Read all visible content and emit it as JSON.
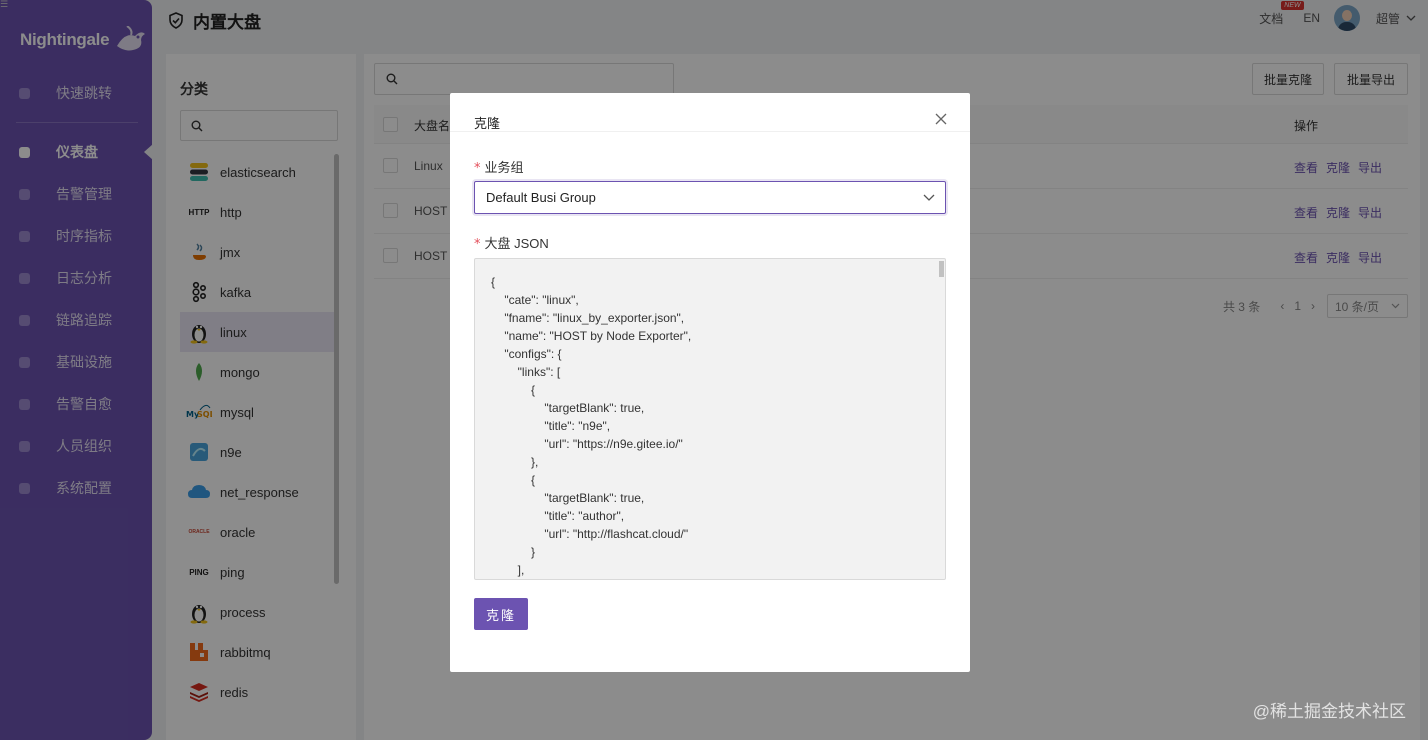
{
  "app": {
    "logo_text": "Nightingale",
    "page_title": "内置大盘"
  },
  "header": {
    "docs": "文档",
    "docs_badge": "NEW",
    "lang": "EN",
    "user": "超管"
  },
  "sidebar": {
    "items": [
      {
        "label": "快速跳转",
        "icon": "search-icon"
      },
      {
        "label": "仪表盘",
        "icon": "dashboard-icon",
        "active": true
      },
      {
        "label": "告警管理",
        "icon": "alarm-icon"
      },
      {
        "label": "时序指标",
        "icon": "line-chart-icon"
      },
      {
        "label": "日志分析",
        "icon": "log-icon"
      },
      {
        "label": "链路追踪",
        "icon": "trace-icon"
      },
      {
        "label": "基础设施",
        "icon": "infra-icon"
      },
      {
        "label": "告警自愈",
        "icon": "terminal-icon"
      },
      {
        "label": "人员组织",
        "icon": "user-icon"
      },
      {
        "label": "系统配置",
        "icon": "settings-icon"
      }
    ]
  },
  "categories": {
    "title": "分类",
    "items": [
      {
        "label": "elasticsearch",
        "icon": "elasticsearch-icon"
      },
      {
        "label": "http",
        "icon": "http-icon",
        "icon_text": "HTTP"
      },
      {
        "label": "jmx",
        "icon": "java-icon"
      },
      {
        "label": "kafka",
        "icon": "kafka-icon"
      },
      {
        "label": "linux",
        "icon": "linux-icon",
        "active": true
      },
      {
        "label": "mongo",
        "icon": "mongo-icon"
      },
      {
        "label": "mysql",
        "icon": "mysql-icon"
      },
      {
        "label": "n9e",
        "icon": "n9e-icon"
      },
      {
        "label": "net_response",
        "icon": "cloud-icon"
      },
      {
        "label": "oracle",
        "icon": "oracle-icon",
        "icon_text": "ORACLE"
      },
      {
        "label": "ping",
        "icon": "ping-icon",
        "icon_text": "PING"
      },
      {
        "label": "process",
        "icon": "linux-icon"
      },
      {
        "label": "rabbitmq",
        "icon": "rabbitmq-icon"
      },
      {
        "label": "redis",
        "icon": "redis-icon"
      }
    ]
  },
  "toolbar": {
    "batch_clone": "批量克隆",
    "batch_export": "批量导出"
  },
  "table": {
    "headers": {
      "name": "大盘名",
      "ops": "操作"
    },
    "rows": [
      {
        "name": "Linux"
      },
      {
        "name": "HOST"
      },
      {
        "name": "HOST"
      }
    ],
    "actions": {
      "view": "查看",
      "clone": "克隆",
      "export": "导出"
    }
  },
  "pager": {
    "total": "共 3 条",
    "page": "1",
    "size": "10 条/页"
  },
  "modal": {
    "title": "克隆",
    "busi_label": "业务组",
    "busi_value": "Default Busi Group",
    "json_label": "大盘 JSON",
    "json_lines": [
      "{",
      "    \"cate\": \"linux\",",
      "    \"fname\": \"linux_by_exporter.json\",",
      "    \"name\": \"HOST by Node Exporter\",",
      "    \"configs\": {",
      "        \"links\": [",
      "            {",
      "                \"targetBlank\": true,",
      "                \"title\": \"n9e\",",
      "                \"url\": \"https://n9e.gitee.io/\"",
      "            },",
      "            {",
      "                \"targetBlank\": true,",
      "                \"title\": \"author\",",
      "                \"url\": \"http://flashcat.cloud/\"",
      "            }",
      "        ],"
    ],
    "submit": "克隆"
  },
  "watermark": "@稀土掘金技术社区",
  "colors": {
    "primary": "#6c53b1",
    "required": "#e34d59"
  }
}
